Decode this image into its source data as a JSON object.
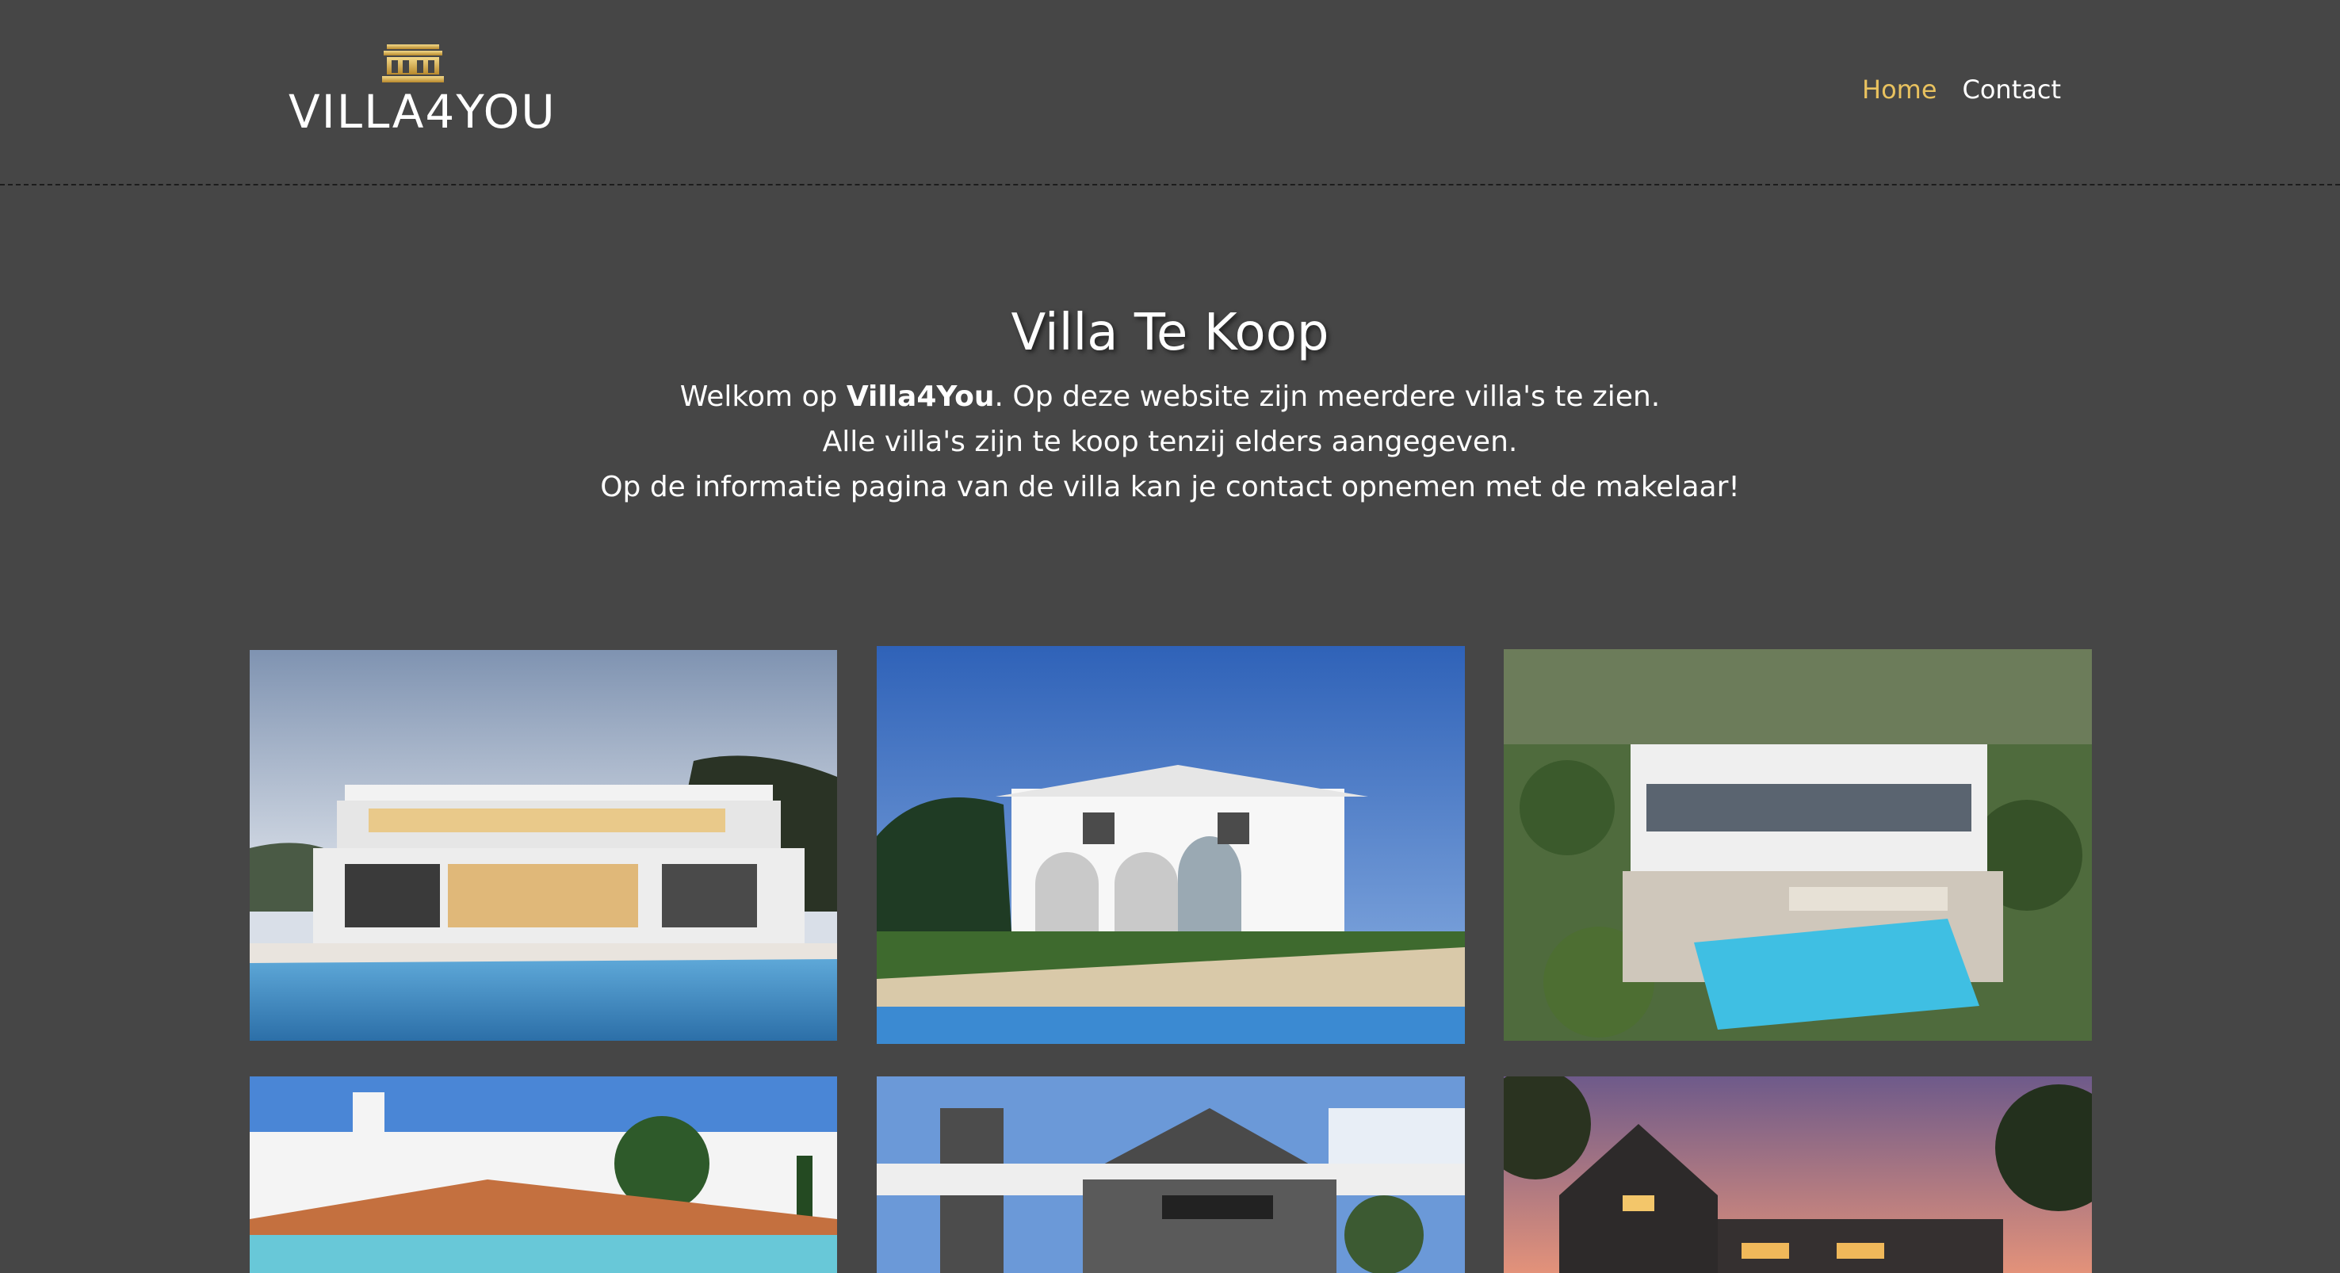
{
  "site": {
    "logo_text": "VILLA4YOU",
    "logo_icon": "villa-house-icon"
  },
  "nav": {
    "items": [
      {
        "label": "Home",
        "active": true
      },
      {
        "label": "Contact",
        "active": false
      }
    ]
  },
  "intro": {
    "title": "Villa Te Koop",
    "line1_before": "Welkom op ",
    "line1_bold": "Villa4You",
    "line1_after": ". Op deze website zijn meerdere villa's te zien.",
    "line2": "Alle villa's zijn te koop tenzij elders aangegeven.",
    "line3": "Op de informatie pagina van de villa kan je contact opnemen met de makelaar!"
  },
  "gallery": {
    "villas": [
      {
        "scene": "modern villa with pool at dusk"
      },
      {
        "scene": "white mediterranean villa with lawn and pool"
      },
      {
        "scene": "aerial view of modern villa with pool"
      },
      {
        "scene": "white villa with terracotta roofs"
      },
      {
        "scene": "modern villa with dark roof and chimney"
      },
      {
        "scene": "dark wooden house at sunset"
      }
    ]
  },
  "colors": {
    "background": "#464646",
    "accent": "#e9c25f",
    "text": "#ffffff",
    "divider": "#1c1c1c"
  }
}
